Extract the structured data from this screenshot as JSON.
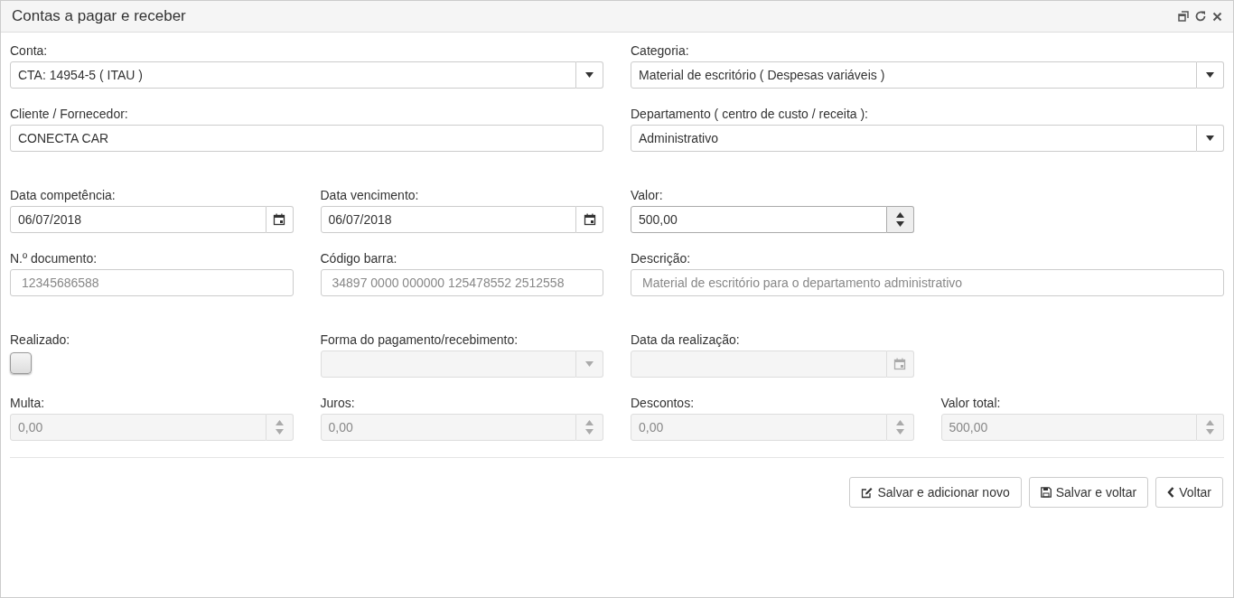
{
  "window": {
    "title": "Contas a pagar e receber"
  },
  "sections": [
    {
      "rows": [
        [
          {
            "kind": "select",
            "label": "Conta:",
            "value": "CTA: 14954-5 ( ITAU )",
            "disabled": false
          },
          {
            "kind": "select",
            "label": "Categoria:",
            "value": "Material de escritório ( Despesas variáveis )",
            "disabled": false
          }
        ],
        [
          {
            "kind": "text",
            "label": "Cliente / Fornecedor:",
            "value": "CONECTA CAR",
            "disabled": false
          },
          {
            "kind": "select",
            "label": "Departamento ( centro de custo / receita ):",
            "value": "Administrativo",
            "disabled": false
          }
        ]
      ]
    },
    {
      "rows": [
        [
          {
            "kind": "date",
            "label": "Data competência:",
            "value": "06/07/2018",
            "disabled": false
          },
          {
            "kind": "date",
            "label": "Data vencimento:",
            "value": "06/07/2018",
            "disabled": false
          },
          {
            "kind": "number",
            "label": "Valor:",
            "value": "500,00",
            "disabled": false
          }
        ],
        [
          {
            "kind": "text",
            "label": "N.º documento:",
            "placeholder": "12345686588",
            "disabled": false
          },
          {
            "kind": "text",
            "label": "Código barra:",
            "placeholder": "34897 0000 000000 125478552 2512558",
            "disabled": false
          },
          {
            "kind": "text",
            "label": "Descrição:",
            "placeholder": "Material de escritório para o departamento administrativo",
            "disabled": false
          }
        ]
      ]
    },
    {
      "rows": [
        [
          {
            "kind": "checkbox",
            "label": "Realizado:",
            "checked": false,
            "disabled": false
          },
          {
            "kind": "select",
            "label": "Forma do pagamento/recebimento:",
            "disabled": true
          },
          {
            "kind": "date",
            "label": "Data da realização:",
            "disabled": true
          }
        ],
        [
          {
            "kind": "number",
            "label": "Multa:",
            "value": "0,00",
            "disabled": true
          },
          {
            "kind": "number",
            "label": "Juros:",
            "value": "0,00",
            "disabled": true
          },
          {
            "kind": "number",
            "label": "Descontos:",
            "value": "0,00",
            "disabled": true
          },
          {
            "kind": "number",
            "label": "Valor total:",
            "value": "500,00",
            "disabled": true
          }
        ]
      ]
    }
  ],
  "buttons": [
    {
      "kind": "edit",
      "label": "Salvar e adicionar novo"
    },
    {
      "kind": "save",
      "label": "Salvar e voltar"
    },
    {
      "kind": "back",
      "label": "Voltar"
    }
  ]
}
